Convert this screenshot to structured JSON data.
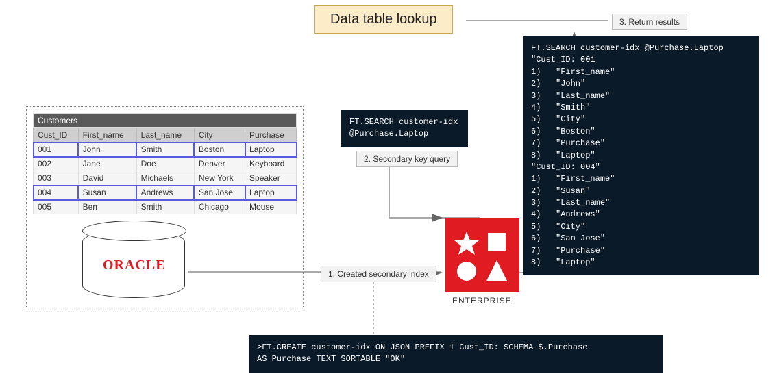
{
  "title": "Data table lookup",
  "steps": {
    "s1": "1. Created secondary index",
    "s2": "2. Secondary key query",
    "s3": "3. Return results"
  },
  "table": {
    "name": "Customers",
    "headers": [
      "Cust_ID",
      "First_name",
      "Last_name",
      "City",
      "Purchase"
    ],
    "rows": [
      {
        "r0": "001",
        "r1": "John",
        "r2": "Smith",
        "r3": "Boston",
        "r4": "Laptop",
        "hl": true
      },
      {
        "r0": "002",
        "r1": "Jane",
        "r2": "Doe",
        "r3": "Denver",
        "r4": "Keyboard"
      },
      {
        "r0": "003",
        "r1": "David",
        "r2": "Michaels",
        "r3": "New York",
        "r4": "Speaker"
      },
      {
        "r0": "004",
        "r1": "Susan",
        "r2": "Andrews",
        "r3": "San Jose",
        "r4": "Laptop",
        "hl": true
      },
      {
        "r0": "005",
        "r1": "Ben",
        "r2": "Smith",
        "r3": "Chicago",
        "r4": "Mouse"
      }
    ]
  },
  "oracle_label": "ORACLE",
  "enterprise_label": "ENTERPRISE",
  "code_query": "FT.SEARCH customer-idx\n@Purchase.Laptop",
  "code_results": "FT.SEARCH customer-idx @Purchase.Laptop\n\"Cust_ID: 001\n1)   \"First_name\"\n2)   \"John\"\n3)   \"Last_name\"\n4)   \"Smith\"\n5)   \"City\"\n6)   \"Boston\"\n7)   \"Purchase\"\n8)   \"Laptop\"\n\"Cust_ID: 004\"\n1)   \"First_name\"\n2)   \"Susan\"\n3)   \"Last_name\"\n4)   \"Andrews\"\n5)   \"City\"\n6)   \"San Jose\"\n7)   \"Purchase\"\n8)   \"Laptop\"",
  "code_create": ">FT.CREATE customer-idx ON JSON PREFIX 1 Cust_ID: SCHEMA $.Purchase\nAS Purchase TEXT SORTABLE \"OK\""
}
